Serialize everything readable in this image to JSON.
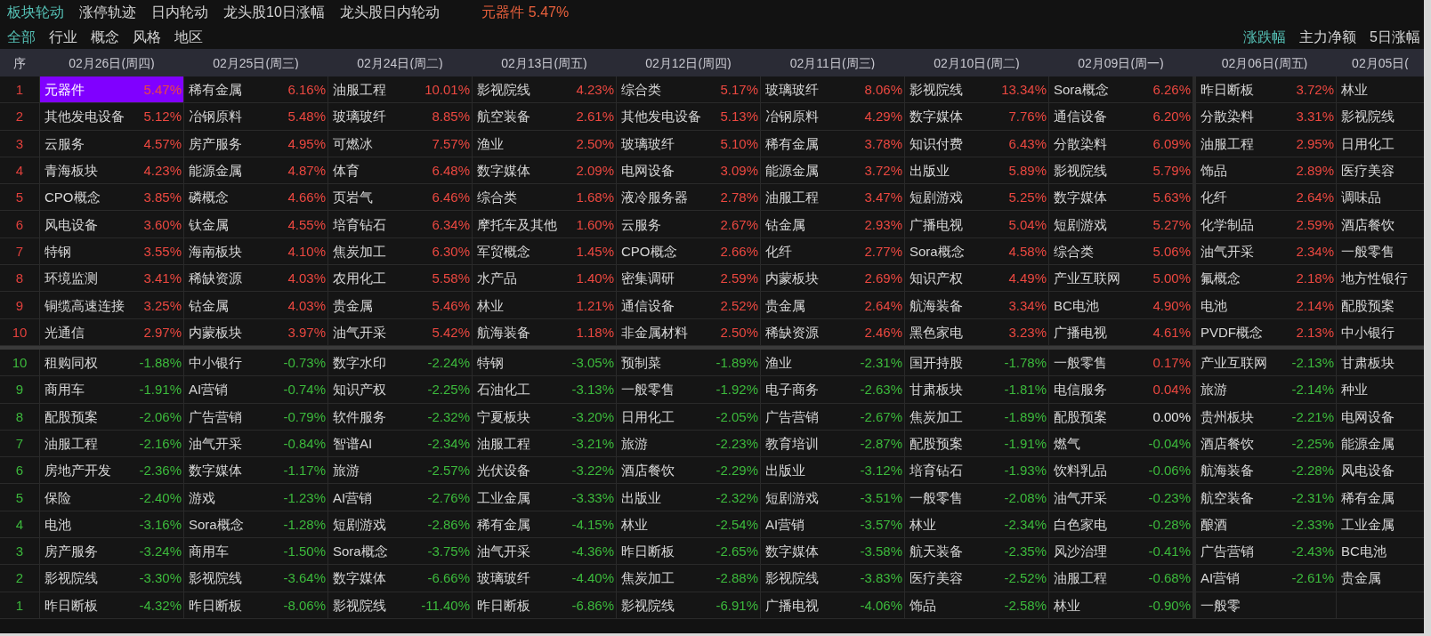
{
  "top_tabs": [
    {
      "label": "板块轮动",
      "selected": true
    },
    {
      "label": "涨停轨迹",
      "selected": false
    },
    {
      "label": "日内轮动",
      "selected": false
    },
    {
      "label": "龙头股10日涨幅",
      "selected": false
    },
    {
      "label": "龙头股日内轮动",
      "selected": false
    }
  ],
  "focus": {
    "name": "元器件",
    "change": "5.47%"
  },
  "filter_tabs": [
    {
      "label": "全部",
      "selected": true
    },
    {
      "label": "行业",
      "selected": false
    },
    {
      "label": "概念",
      "selected": false
    },
    {
      "label": "风格",
      "selected": false
    },
    {
      "label": "地区",
      "selected": false
    }
  ],
  "metric_tabs": [
    {
      "label": "涨跌幅",
      "selected": true
    },
    {
      "label": "主力净额",
      "selected": false
    },
    {
      "label": "5日涨幅",
      "selected": false
    }
  ],
  "table": {
    "columns": [
      "序",
      "02月26日(周四)",
      "02月25日(周三)",
      "02月24日(周二)",
      "02月13日(周五)",
      "02月12日(周四)",
      "02月11日(周三)",
      "02月10日(周二)",
      "02月09日(周一)",
      "02月06日(周五)",
      "02月05日("
    ],
    "sections": [
      {
        "kind": "gainers",
        "rows": [
          {
            "rank": "1",
            "cells": [
              {
                "name": "元器件",
                "change": "5.47%",
                "color": "#ec4840",
                "selected": true
              },
              {
                "name": "稀有金属",
                "change": "6.16%",
                "color": "#ec4840",
                "selected": false
              },
              {
                "name": "油服工程",
                "change": "10.01%",
                "color": "#ec4840",
                "selected": false
              },
              {
                "name": "影视院线",
                "change": "4.23%",
                "color": "#ec4840",
                "selected": false
              },
              {
                "name": "综合类",
                "change": "5.17%",
                "color": "#ec4840",
                "selected": false
              },
              {
                "name": "玻璃玻纤",
                "change": "8.06%",
                "color": "#ec4840",
                "selected": false
              },
              {
                "name": "影视院线",
                "change": "13.34%",
                "color": "#ec4840",
                "selected": false
              },
              {
                "name": "Sora概念",
                "change": "6.26%",
                "color": "#ec4840",
                "selected": false
              },
              {
                "name": "昨日断板",
                "change": "3.72%",
                "color": "#ec4840",
                "selected": false
              },
              {
                "name": "林业",
                "selected": false
              }
            ]
          },
          {
            "rank": "2",
            "cells": [
              {
                "name": "其他发电设备",
                "change": "5.12%",
                "color": "#ec4840",
                "selected": false
              },
              {
                "name": "冶钢原料",
                "change": "5.48%",
                "color": "#ec4840",
                "selected": false
              },
              {
                "name": "玻璃玻纤",
                "change": "8.85%",
                "color": "#ec4840",
                "selected": false
              },
              {
                "name": "航空装备",
                "change": "2.61%",
                "color": "#ec4840",
                "selected": false
              },
              {
                "name": "其他发电设备",
                "change": "5.13%",
                "color": "#ec4840",
                "selected": false
              },
              {
                "name": "冶钢原料",
                "change": "4.29%",
                "color": "#ec4840",
                "selected": false
              },
              {
                "name": "数字媒体",
                "change": "7.76%",
                "color": "#ec4840",
                "selected": false
              },
              {
                "name": "通信设备",
                "change": "6.20%",
                "color": "#ec4840",
                "selected": false
              },
              {
                "name": "分散染料",
                "change": "3.31%",
                "color": "#ec4840",
                "selected": false
              },
              {
                "name": "影视院线",
                "selected": false
              }
            ]
          },
          {
            "rank": "3",
            "cells": [
              {
                "name": "云服务",
                "change": "4.57%",
                "color": "#ec4840",
                "selected": false
              },
              {
                "name": "房产服务",
                "change": "4.95%",
                "color": "#ec4840",
                "selected": false
              },
              {
                "name": "可燃冰",
                "change": "7.57%",
                "color": "#ec4840",
                "selected": false
              },
              {
                "name": "渔业",
                "change": "2.50%",
                "color": "#ec4840",
                "selected": false
              },
              {
                "name": "玻璃玻纤",
                "change": "5.10%",
                "color": "#ec4840",
                "selected": false
              },
              {
                "name": "稀有金属",
                "change": "3.78%",
                "color": "#ec4840",
                "selected": false
              },
              {
                "name": "知识付费",
                "change": "6.43%",
                "color": "#ec4840",
                "selected": false
              },
              {
                "name": "分散染料",
                "change": "6.09%",
                "color": "#ec4840",
                "selected": false
              },
              {
                "name": "油服工程",
                "change": "2.95%",
                "color": "#ec4840",
                "selected": false
              },
              {
                "name": "日用化工",
                "selected": false
              }
            ]
          },
          {
            "rank": "4",
            "cells": [
              {
                "name": "青海板块",
                "change": "4.23%",
                "color": "#ec4840",
                "selected": false
              },
              {
                "name": "能源金属",
                "change": "4.87%",
                "color": "#ec4840",
                "selected": false
              },
              {
                "name": "体育",
                "change": "6.48%",
                "color": "#ec4840",
                "selected": false
              },
              {
                "name": "数字媒体",
                "change": "2.09%",
                "color": "#ec4840",
                "selected": false
              },
              {
                "name": "电网设备",
                "change": "3.09%",
                "color": "#ec4840",
                "selected": false
              },
              {
                "name": "能源金属",
                "change": "3.72%",
                "color": "#ec4840",
                "selected": false
              },
              {
                "name": "出版业",
                "change": "5.89%",
                "color": "#ec4840",
                "selected": false
              },
              {
                "name": "影视院线",
                "change": "5.79%",
                "color": "#ec4840",
                "selected": false
              },
              {
                "name": "饰品",
                "change": "2.89%",
                "color": "#ec4840",
                "selected": false
              },
              {
                "name": "医疗美容",
                "selected": false
              }
            ]
          },
          {
            "rank": "5",
            "cells": [
              {
                "name": "CPO概念",
                "change": "3.85%",
                "color": "#ec4840",
                "selected": false
              },
              {
                "name": "磷概念",
                "change": "4.66%",
                "color": "#ec4840",
                "selected": false
              },
              {
                "name": "页岩气",
                "change": "6.46%",
                "color": "#ec4840",
                "selected": false
              },
              {
                "name": "综合类",
                "change": "1.68%",
                "color": "#ec4840",
                "selected": false
              },
              {
                "name": "液冷服务器",
                "change": "2.78%",
                "color": "#ec4840",
                "selected": false
              },
              {
                "name": "油服工程",
                "change": "3.47%",
                "color": "#ec4840",
                "selected": false
              },
              {
                "name": "短剧游戏",
                "change": "5.25%",
                "color": "#ec4840",
                "selected": false
              },
              {
                "name": "数字媒体",
                "change": "5.63%",
                "color": "#ec4840",
                "selected": false
              },
              {
                "name": "化纤",
                "change": "2.64%",
                "color": "#ec4840",
                "selected": false
              },
              {
                "name": "调味品",
                "selected": false
              }
            ]
          },
          {
            "rank": "6",
            "cells": [
              {
                "name": "风电设备",
                "change": "3.60%",
                "color": "#ec4840",
                "selected": false
              },
              {
                "name": "钛金属",
                "change": "4.55%",
                "color": "#ec4840",
                "selected": false
              },
              {
                "name": "培育钻石",
                "change": "6.34%",
                "color": "#ec4840",
                "selected": false
              },
              {
                "name": "摩托车及其他",
                "change": "1.60%",
                "color": "#ec4840",
                "selected": false
              },
              {
                "name": "云服务",
                "change": "2.67%",
                "color": "#ec4840",
                "selected": false
              },
              {
                "name": "钴金属",
                "change": "2.93%",
                "color": "#ec4840",
                "selected": false
              },
              {
                "name": "广播电视",
                "change": "5.04%",
                "color": "#ec4840",
                "selected": false
              },
              {
                "name": "短剧游戏",
                "change": "5.27%",
                "color": "#ec4840",
                "selected": false
              },
              {
                "name": "化学制品",
                "change": "2.59%",
                "color": "#ec4840",
                "selected": false
              },
              {
                "name": "酒店餐饮",
                "selected": false
              }
            ]
          },
          {
            "rank": "7",
            "cells": [
              {
                "name": "特钢",
                "change": "3.55%",
                "color": "#ec4840",
                "selected": false
              },
              {
                "name": "海南板块",
                "change": "4.10%",
                "color": "#ec4840",
                "selected": false
              },
              {
                "name": "焦炭加工",
                "change": "6.30%",
                "color": "#ec4840",
                "selected": false
              },
              {
                "name": "军贸概念",
                "change": "1.45%",
                "color": "#ec4840",
                "selected": false
              },
              {
                "name": "CPO概念",
                "change": "2.66%",
                "color": "#ec4840",
                "selected": false
              },
              {
                "name": "化纤",
                "change": "2.77%",
                "color": "#ec4840",
                "selected": false
              },
              {
                "name": "Sora概念",
                "change": "4.58%",
                "color": "#ec4840",
                "selected": false
              },
              {
                "name": "综合类",
                "change": "5.06%",
                "color": "#ec4840",
                "selected": false
              },
              {
                "name": "油气开采",
                "change": "2.34%",
                "color": "#ec4840",
                "selected": false
              },
              {
                "name": "一般零售",
                "selected": false
              }
            ]
          },
          {
            "rank": "8",
            "cells": [
              {
                "name": "环境监测",
                "change": "3.41%",
                "color": "#ec4840",
                "selected": false
              },
              {
                "name": "稀缺资源",
                "change": "4.03%",
                "color": "#ec4840",
                "selected": false
              },
              {
                "name": "农用化工",
                "change": "5.58%",
                "color": "#ec4840",
                "selected": false
              },
              {
                "name": "水产品",
                "change": "1.40%",
                "color": "#ec4840",
                "selected": false
              },
              {
                "name": "密集调研",
                "change": "2.59%",
                "color": "#ec4840",
                "selected": false
              },
              {
                "name": "内蒙板块",
                "change": "2.69%",
                "color": "#ec4840",
                "selected": false
              },
              {
                "name": "知识产权",
                "change": "4.49%",
                "color": "#ec4840",
                "selected": false
              },
              {
                "name": "产业互联网",
                "change": "5.00%",
                "color": "#ec4840",
                "selected": false
              },
              {
                "name": "氟概念",
                "change": "2.18%",
                "color": "#ec4840",
                "selected": false
              },
              {
                "name": "地方性银行",
                "selected": false
              }
            ]
          },
          {
            "rank": "9",
            "cells": [
              {
                "name": "铜缆高速连接",
                "change": "3.25%",
                "color": "#ec4840",
                "selected": false
              },
              {
                "name": "钴金属",
                "change": "4.03%",
                "color": "#ec4840",
                "selected": false
              },
              {
                "name": "贵金属",
                "change": "5.46%",
                "color": "#ec4840",
                "selected": false
              },
              {
                "name": "林业",
                "change": "1.21%",
                "color": "#ec4840",
                "selected": false
              },
              {
                "name": "通信设备",
                "change": "2.52%",
                "color": "#ec4840",
                "selected": false
              },
              {
                "name": "贵金属",
                "change": "2.64%",
                "color": "#ec4840",
                "selected": false
              },
              {
                "name": "航海装备",
                "change": "3.34%",
                "color": "#ec4840",
                "selected": false
              },
              {
                "name": "BC电池",
                "change": "4.90%",
                "color": "#ec4840",
                "selected": false
              },
              {
                "name": "电池",
                "change": "2.14%",
                "color": "#ec4840",
                "selected": false
              },
              {
                "name": "配股预案",
                "selected": false
              }
            ]
          },
          {
            "rank": "10",
            "cells": [
              {
                "name": "光通信",
                "change": "2.97%",
                "color": "#ec4840",
                "selected": false
              },
              {
                "name": "内蒙板块",
                "change": "3.97%",
                "color": "#ec4840",
                "selected": false
              },
              {
                "name": "油气开采",
                "change": "5.42%",
                "color": "#ec4840",
                "selected": false
              },
              {
                "name": "航海装备",
                "change": "1.18%",
                "color": "#ec4840",
                "selected": false
              },
              {
                "name": "非金属材料",
                "change": "2.50%",
                "color": "#ec4840",
                "selected": false
              },
              {
                "name": "稀缺资源",
                "change": "2.46%",
                "color": "#ec4840",
                "selected": false
              },
              {
                "name": "黑色家电",
                "change": "3.23%",
                "color": "#ec4840",
                "selected": false
              },
              {
                "name": "广播电视",
                "change": "4.61%",
                "color": "#ec4840",
                "selected": false
              },
              {
                "name": "PVDF概念",
                "change": "2.13%",
                "color": "#ec4840",
                "selected": false
              },
              {
                "name": "中小银行",
                "selected": false
              }
            ]
          }
        ]
      },
      {
        "kind": "losers",
        "rows": [
          {
            "rank": "10",
            "cells": [
              {
                "name": "租购同权",
                "change": "-1.88%",
                "color": "#3cba3c",
                "selected": false
              },
              {
                "name": "中小银行",
                "change": "-0.73%",
                "color": "#3cba3c",
                "selected": false
              },
              {
                "name": "数字水印",
                "change": "-2.24%",
                "color": "#3cba3c",
                "selected": false
              },
              {
                "name": "特钢",
                "change": "-3.05%",
                "color": "#3cba3c",
                "selected": false
              },
              {
                "name": "预制菜",
                "change": "-1.89%",
                "color": "#3cba3c",
                "selected": false
              },
              {
                "name": "渔业",
                "change": "-2.31%",
                "color": "#3cba3c",
                "selected": false
              },
              {
                "name": "国开持股",
                "change": "-1.78%",
                "color": "#3cba3c",
                "selected": false
              },
              {
                "name": "一般零售",
                "change": "0.17%",
                "color": "#ec4840",
                "selected": false
              },
              {
                "name": "产业互联网",
                "change": "-2.13%",
                "color": "#3cba3c",
                "selected": false
              },
              {
                "name": "甘肃板块",
                "selected": false
              }
            ]
          },
          {
            "rank": "9",
            "cells": [
              {
                "name": "商用车",
                "change": "-1.91%",
                "color": "#3cba3c",
                "selected": false
              },
              {
                "name": "AI营销",
                "change": "-0.74%",
                "color": "#3cba3c",
                "selected": false
              },
              {
                "name": "知识产权",
                "change": "-2.25%",
                "color": "#3cba3c",
                "selected": false
              },
              {
                "name": "石油化工",
                "change": "-3.13%",
                "color": "#3cba3c",
                "selected": false
              },
              {
                "name": "一般零售",
                "change": "-1.92%",
                "color": "#3cba3c",
                "selected": false
              },
              {
                "name": "电子商务",
                "change": "-2.63%",
                "color": "#3cba3c",
                "selected": false
              },
              {
                "name": "甘肃板块",
                "change": "-1.81%",
                "color": "#3cba3c",
                "selected": false
              },
              {
                "name": "电信服务",
                "change": "0.04%",
                "color": "#ec4840",
                "selected": false
              },
              {
                "name": "旅游",
                "change": "-2.14%",
                "color": "#3cba3c",
                "selected": false
              },
              {
                "name": "种业",
                "selected": false
              }
            ]
          },
          {
            "rank": "8",
            "cells": [
              {
                "name": "配股预案",
                "change": "-2.06%",
                "color": "#3cba3c",
                "selected": false
              },
              {
                "name": "广告营销",
                "change": "-0.79%",
                "color": "#3cba3c",
                "selected": false
              },
              {
                "name": "软件服务",
                "change": "-2.32%",
                "color": "#3cba3c",
                "selected": false
              },
              {
                "name": "宁夏板块",
                "change": "-3.20%",
                "color": "#3cba3c",
                "selected": false
              },
              {
                "name": "日用化工",
                "change": "-2.05%",
                "color": "#3cba3c",
                "selected": false
              },
              {
                "name": "广告营销",
                "change": "-2.67%",
                "color": "#3cba3c",
                "selected": false
              },
              {
                "name": "焦炭加工",
                "change": "-1.89%",
                "color": "#3cba3c",
                "selected": false
              },
              {
                "name": "配股预案",
                "change": "0.00%",
                "color": "#e6e6e6",
                "selected": false
              },
              {
                "name": "贵州板块",
                "change": "-2.21%",
                "color": "#3cba3c",
                "selected": false
              },
              {
                "name": "电网设备",
                "selected": false
              }
            ]
          },
          {
            "rank": "7",
            "cells": [
              {
                "name": "油服工程",
                "change": "-2.16%",
                "color": "#3cba3c",
                "selected": false
              },
              {
                "name": "油气开采",
                "change": "-0.84%",
                "color": "#3cba3c",
                "selected": false
              },
              {
                "name": "智谱AI",
                "change": "-2.34%",
                "color": "#3cba3c",
                "selected": false
              },
              {
                "name": "油服工程",
                "change": "-3.21%",
                "color": "#3cba3c",
                "selected": false
              },
              {
                "name": "旅游",
                "change": "-2.23%",
                "color": "#3cba3c",
                "selected": false
              },
              {
                "name": "教育培训",
                "change": "-2.87%",
                "color": "#3cba3c",
                "selected": false
              },
              {
                "name": "配股预案",
                "change": "-1.91%",
                "color": "#3cba3c",
                "selected": false
              },
              {
                "name": "燃气",
                "change": "-0.04%",
                "color": "#3cba3c",
                "selected": false
              },
              {
                "name": "酒店餐饮",
                "change": "-2.25%",
                "color": "#3cba3c",
                "selected": false
              },
              {
                "name": "能源金属",
                "selected": false
              }
            ]
          },
          {
            "rank": "6",
            "cells": [
              {
                "name": "房地产开发",
                "change": "-2.36%",
                "color": "#3cba3c",
                "selected": false
              },
              {
                "name": "数字媒体",
                "change": "-1.17%",
                "color": "#3cba3c",
                "selected": false
              },
              {
                "name": "旅游",
                "change": "-2.57%",
                "color": "#3cba3c",
                "selected": false
              },
              {
                "name": "光伏设备",
                "change": "-3.22%",
                "color": "#3cba3c",
                "selected": false
              },
              {
                "name": "酒店餐饮",
                "change": "-2.29%",
                "color": "#3cba3c",
                "selected": false
              },
              {
                "name": "出版业",
                "change": "-3.12%",
                "color": "#3cba3c",
                "selected": false
              },
              {
                "name": "培育钻石",
                "change": "-1.93%",
                "color": "#3cba3c",
                "selected": false
              },
              {
                "name": "饮料乳品",
                "change": "-0.06%",
                "color": "#3cba3c",
                "selected": false
              },
              {
                "name": "航海装备",
                "change": "-2.28%",
                "color": "#3cba3c",
                "selected": false
              },
              {
                "name": "风电设备",
                "selected": false
              }
            ]
          },
          {
            "rank": "5",
            "cells": [
              {
                "name": "保险",
                "change": "-2.40%",
                "color": "#3cba3c",
                "selected": false
              },
              {
                "name": "游戏",
                "change": "-1.23%",
                "color": "#3cba3c",
                "selected": false
              },
              {
                "name": "AI营销",
                "change": "-2.76%",
                "color": "#3cba3c",
                "selected": false
              },
              {
                "name": "工业金属",
                "change": "-3.33%",
                "color": "#3cba3c",
                "selected": false
              },
              {
                "name": "出版业",
                "change": "-2.32%",
                "color": "#3cba3c",
                "selected": false
              },
              {
                "name": "短剧游戏",
                "change": "-3.51%",
                "color": "#3cba3c",
                "selected": false
              },
              {
                "name": "一般零售",
                "change": "-2.08%",
                "color": "#3cba3c",
                "selected": false
              },
              {
                "name": "油气开采",
                "change": "-0.23%",
                "color": "#3cba3c",
                "selected": false
              },
              {
                "name": "航空装备",
                "change": "-2.31%",
                "color": "#3cba3c",
                "selected": false
              },
              {
                "name": "稀有金属",
                "selected": false
              }
            ]
          },
          {
            "rank": "4",
            "cells": [
              {
                "name": "电池",
                "change": "-3.16%",
                "color": "#3cba3c",
                "selected": false
              },
              {
                "name": "Sora概念",
                "change": "-1.28%",
                "color": "#3cba3c",
                "selected": false
              },
              {
                "name": "短剧游戏",
                "change": "-2.86%",
                "color": "#3cba3c",
                "selected": false
              },
              {
                "name": "稀有金属",
                "change": "-4.15%",
                "color": "#3cba3c",
                "selected": false
              },
              {
                "name": "林业",
                "change": "-2.54%",
                "color": "#3cba3c",
                "selected": false
              },
              {
                "name": "AI营销",
                "change": "-3.57%",
                "color": "#3cba3c",
                "selected": false
              },
              {
                "name": "林业",
                "change": "-2.34%",
                "color": "#3cba3c",
                "selected": false
              },
              {
                "name": "白色家电",
                "change": "-0.28%",
                "color": "#3cba3c",
                "selected": false
              },
              {
                "name": "酿酒",
                "change": "-2.33%",
                "color": "#3cba3c",
                "selected": false
              },
              {
                "name": "工业金属",
                "selected": false
              }
            ]
          },
          {
            "rank": "3",
            "cells": [
              {
                "name": "房产服务",
                "change": "-3.24%",
                "color": "#3cba3c",
                "selected": false
              },
              {
                "name": "商用车",
                "change": "-1.50%",
                "color": "#3cba3c",
                "selected": false
              },
              {
                "name": "Sora概念",
                "change": "-3.75%",
                "color": "#3cba3c",
                "selected": false
              },
              {
                "name": "油气开采",
                "change": "-4.36%",
                "color": "#3cba3c",
                "selected": false
              },
              {
                "name": "昨日断板",
                "change": "-2.65%",
                "color": "#3cba3c",
                "selected": false
              },
              {
                "name": "数字媒体",
                "change": "-3.58%",
                "color": "#3cba3c",
                "selected": false
              },
              {
                "name": "航天装备",
                "change": "-2.35%",
                "color": "#3cba3c",
                "selected": false
              },
              {
                "name": "风沙治理",
                "change": "-0.41%",
                "color": "#3cba3c",
                "selected": false
              },
              {
                "name": "广告营销",
                "change": "-2.43%",
                "color": "#3cba3c",
                "selected": false
              },
              {
                "name": "BC电池",
                "selected": false
              }
            ]
          },
          {
            "rank": "2",
            "cells": [
              {
                "name": "影视院线",
                "change": "-3.30%",
                "color": "#3cba3c",
                "selected": false
              },
              {
                "name": "影视院线",
                "change": "-3.64%",
                "color": "#3cba3c",
                "selected": false
              },
              {
                "name": "数字媒体",
                "change": "-6.66%",
                "color": "#3cba3c",
                "selected": false
              },
              {
                "name": "玻璃玻纤",
                "change": "-4.40%",
                "color": "#3cba3c",
                "selected": false
              },
              {
                "name": "焦炭加工",
                "change": "-2.88%",
                "color": "#3cba3c",
                "selected": false
              },
              {
                "name": "影视院线",
                "change": "-3.83%",
                "color": "#3cba3c",
                "selected": false
              },
              {
                "name": "医疗美容",
                "change": "-2.52%",
                "color": "#3cba3c",
                "selected": false
              },
              {
                "name": "油服工程",
                "change": "-0.68%",
                "color": "#3cba3c",
                "selected": false
              },
              {
                "name": "AI营销",
                "change": "-2.61%",
                "color": "#3cba3c",
                "selected": false
              },
              {
                "name": "贵金属",
                "selected": false
              }
            ]
          },
          {
            "rank": "1",
            "cells": [
              {
                "name": "昨日断板",
                "change": "-4.32%",
                "color": "#3cba3c",
                "selected": false
              },
              {
                "name": "昨日断板",
                "change": "-8.06%",
                "color": "#3cba3c",
                "selected": false
              },
              {
                "name": "影视院线",
                "change": "-11.40%",
                "color": "#3cba3c",
                "selected": false
              },
              {
                "name": "昨日断板",
                "change": "-6.86%",
                "color": "#3cba3c",
                "selected": false
              },
              {
                "name": "影视院线",
                "change": "-6.91%",
                "color": "#3cba3c",
                "selected": false
              },
              {
                "name": "广播电视",
                "change": "-4.06%",
                "color": "#3cba3c",
                "selected": false
              },
              {
                "name": "饰品",
                "change": "-2.58%",
                "color": "#3cba3c",
                "selected": false
              },
              {
                "name": "林业",
                "change": "-0.90%",
                "color": "#3cba3c",
                "selected": false
              },
              {
                "name": "一般零",
                "selected": false
              }
            ]
          }
        ]
      }
    ]
  }
}
